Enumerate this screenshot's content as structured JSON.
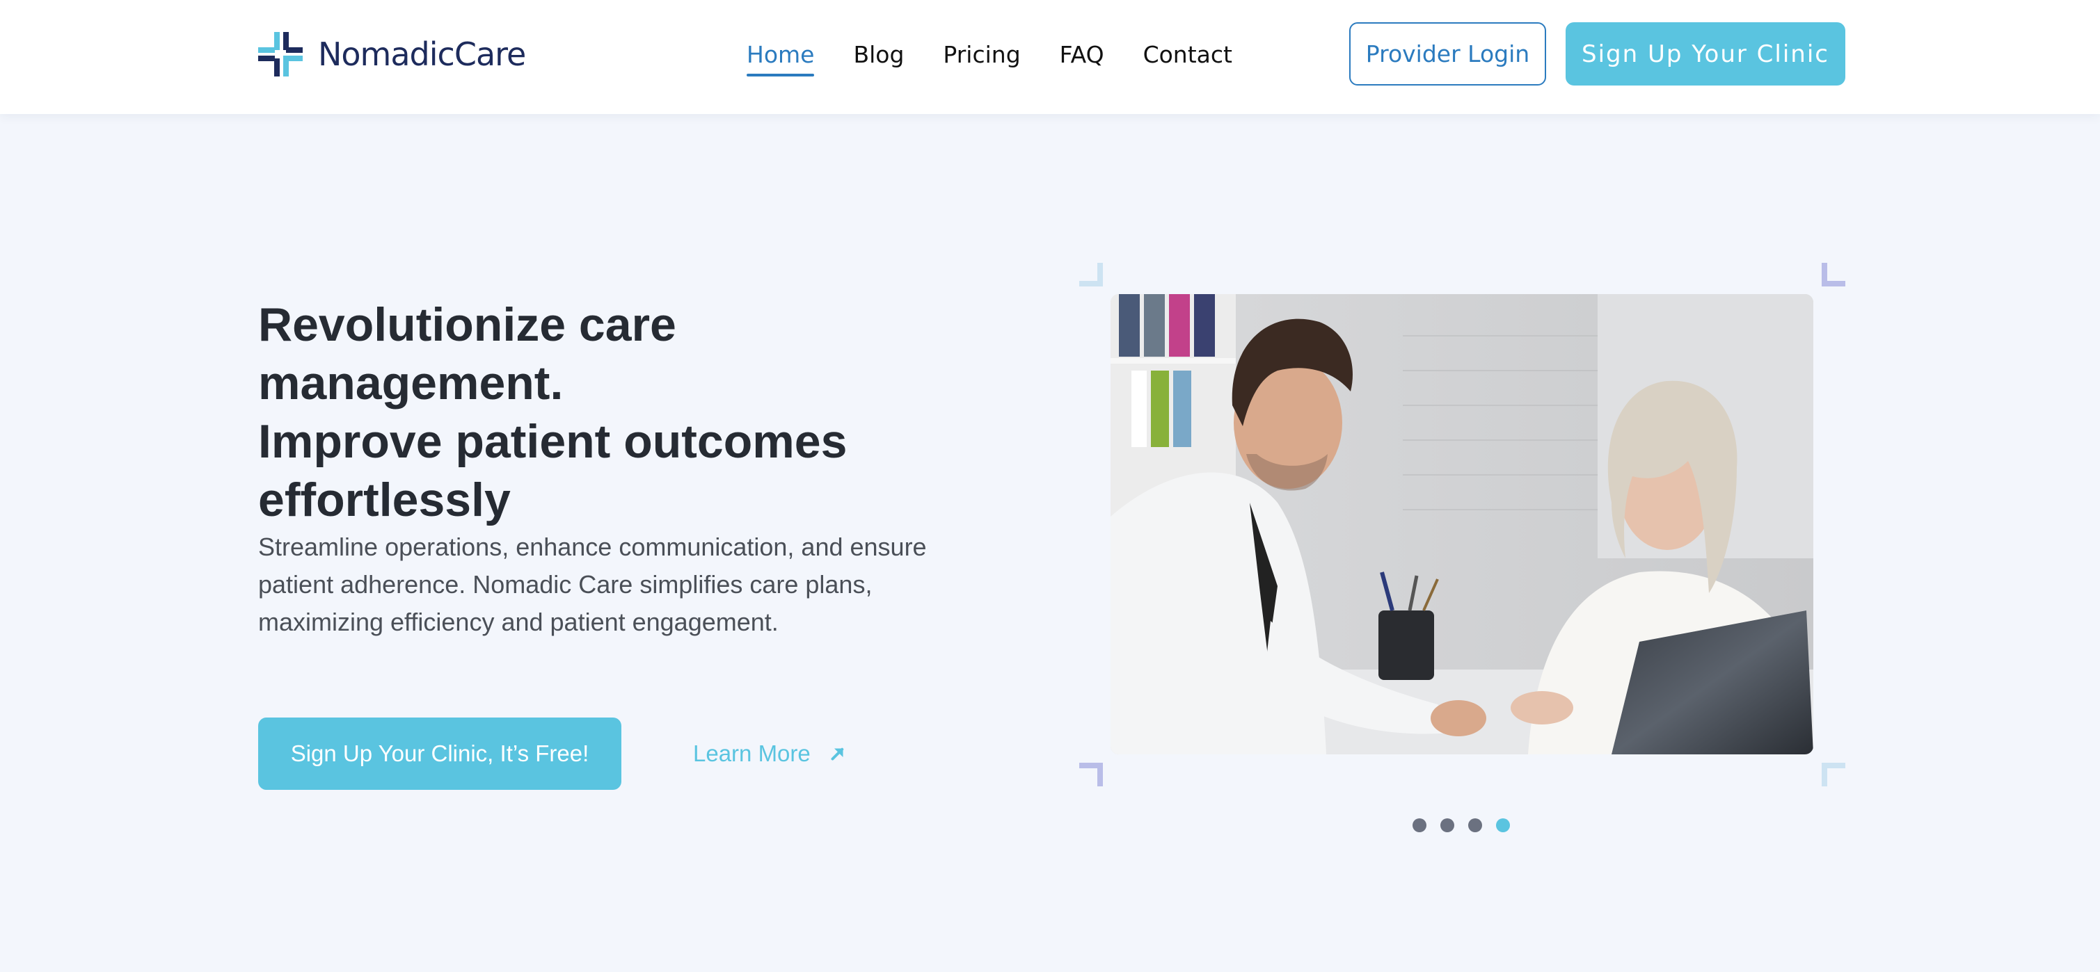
{
  "header": {
    "logo_text": "NomadicCare",
    "nav": [
      {
        "label": "Home",
        "active": true
      },
      {
        "label": "Blog"
      },
      {
        "label": "Pricing"
      },
      {
        "label": "FAQ"
      },
      {
        "label": "Contact"
      }
    ],
    "login_label": "Provider Login",
    "signup_label": "Sign Up Your Clinic"
  },
  "hero": {
    "headline_lines": [
      "Revolutionize care management.",
      "Improve patient outcomes",
      "effortlessly"
    ],
    "subtext": "Streamline operations, enhance communication, and ensure patient adherence. Nomadic Care simplifies care plans, maximizing efficiency and patient engagement.",
    "cta_label": "Sign Up Your Clinic, It’s Free!",
    "learn_more_label": "Learn More",
    "carousel": {
      "total": 4,
      "active_index": 3
    }
  },
  "colors": {
    "accent": "#5ac4e0",
    "link": "#2b7bbf",
    "brand_navy": "#1d2b5c",
    "background": "#f3f6fc"
  }
}
